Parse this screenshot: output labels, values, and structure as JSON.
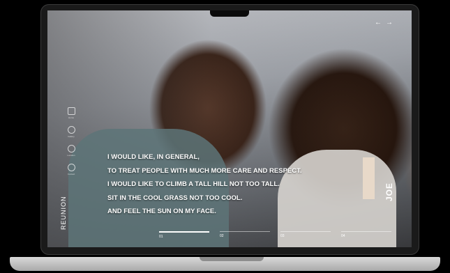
{
  "nav": {
    "prev_arrow": "←",
    "next_arrow": "→"
  },
  "sidebar": {
    "items": [
      {
        "label": "Home",
        "icon": "image-icon"
      },
      {
        "label": "Gallery",
        "icon": "circle-icon"
      },
      {
        "label": "Location",
        "icon": "pin-icon"
      },
      {
        "label": "Contact",
        "icon": "hand-icon"
      }
    ]
  },
  "brand": {
    "name": "REUNION"
  },
  "quote": {
    "lines": [
      "I WOULD LIKE, IN GENERAL,",
      "TO TREAT PEOPLE WITH MUCH MORE CARE AND RESPECT.",
      "I WOULD LIKE TO CLIMB A TALL HILL NOT TOO TALL.",
      "SIT IN THE COOL GRASS NOT TOO COOL.",
      "AND FEEL THE SUN ON MY FACE."
    ]
  },
  "person": {
    "name": "JOE"
  },
  "slides": [
    {
      "num": "01"
    },
    {
      "num": "02"
    },
    {
      "num": "03"
    },
    {
      "num": "04"
    }
  ],
  "colors": {
    "accent": "#e8d9c9",
    "text": "#ffffff",
    "bezel": "#1a1a1a"
  }
}
